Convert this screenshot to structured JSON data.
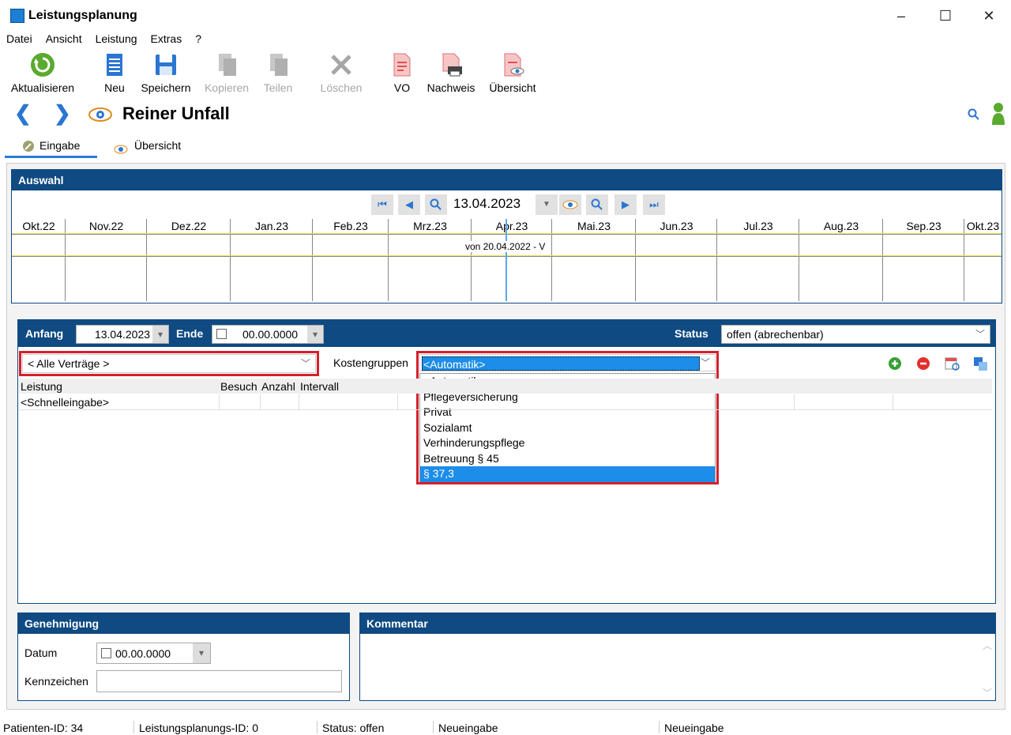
{
  "window": {
    "title": "Leistungsplanung",
    "minimize": "–",
    "maximize": "☐",
    "close": "✕"
  },
  "menu": [
    "Datei",
    "Ansicht",
    "Leistung",
    "Extras",
    "?"
  ],
  "toolbar": {
    "refresh": "Aktualisieren",
    "new": "Neu",
    "save": "Speichern",
    "copy": "Kopieren",
    "share": "Teilen",
    "delete": "Löschen",
    "vo": "VO",
    "proof": "Nachweis",
    "overview": "Übersicht"
  },
  "page": {
    "title": "Reiner Unfall"
  },
  "tabs": {
    "input": "Eingabe",
    "overview": "Übersicht"
  },
  "auswahl": {
    "header": "Auswahl",
    "date": "13.04.2023",
    "months": [
      "Okt.22",
      "Nov.22",
      "Dez.22",
      "Jan.23",
      "Feb.23",
      "Mrz.23",
      "Apr.23",
      "Mai.23",
      "Jun.23",
      "Jul.23",
      "Aug.23",
      "Sep.23",
      "Okt.23"
    ],
    "bar_text": "von 20.04.2022 - V"
  },
  "form": {
    "start_label": "Anfang",
    "start_value": "13.04.2023",
    "end_label": "Ende",
    "end_value": "00.00.0000",
    "status_label": "Status",
    "status_value": "offen (abrechenbar)",
    "contracts_value": "< Alle Verträge >",
    "cost_label": "Kostengruppen",
    "cost_value": "<Automatik>",
    "cost_options": [
      "<Automatik>",
      "Pflegeversicherung",
      "Privat",
      "Sozialamt",
      "Verhinderungspflege",
      "Betreuung § 45",
      "§ 37,3"
    ],
    "cost_selected_index": 6,
    "col_service": "Leistung",
    "col_visit": "Besuch",
    "col_count": "Anzahl",
    "col_interval": "Intervall",
    "row_quick": "<Schnelleingabe>"
  },
  "genehmigung": {
    "header": "Genehmigung",
    "date_label": "Datum",
    "date_value": "00.00.0000",
    "mark_label": "Kennzeichen",
    "mark_value": ""
  },
  "kommentar": {
    "header": "Kommentar",
    "text": ""
  },
  "statusbar": {
    "patient": "Patienten-ID: 34",
    "plan": "Leistungsplanungs-ID: 0",
    "status": "Status: offen",
    "mode1": "Neueingabe",
    "mode2": "Neueingabe"
  },
  "colors": {
    "panel_blue": "#0f4a82",
    "select_blue": "#1c8de9",
    "highlight_red": "#d61f2b",
    "accent_blue": "#2a76d2"
  }
}
